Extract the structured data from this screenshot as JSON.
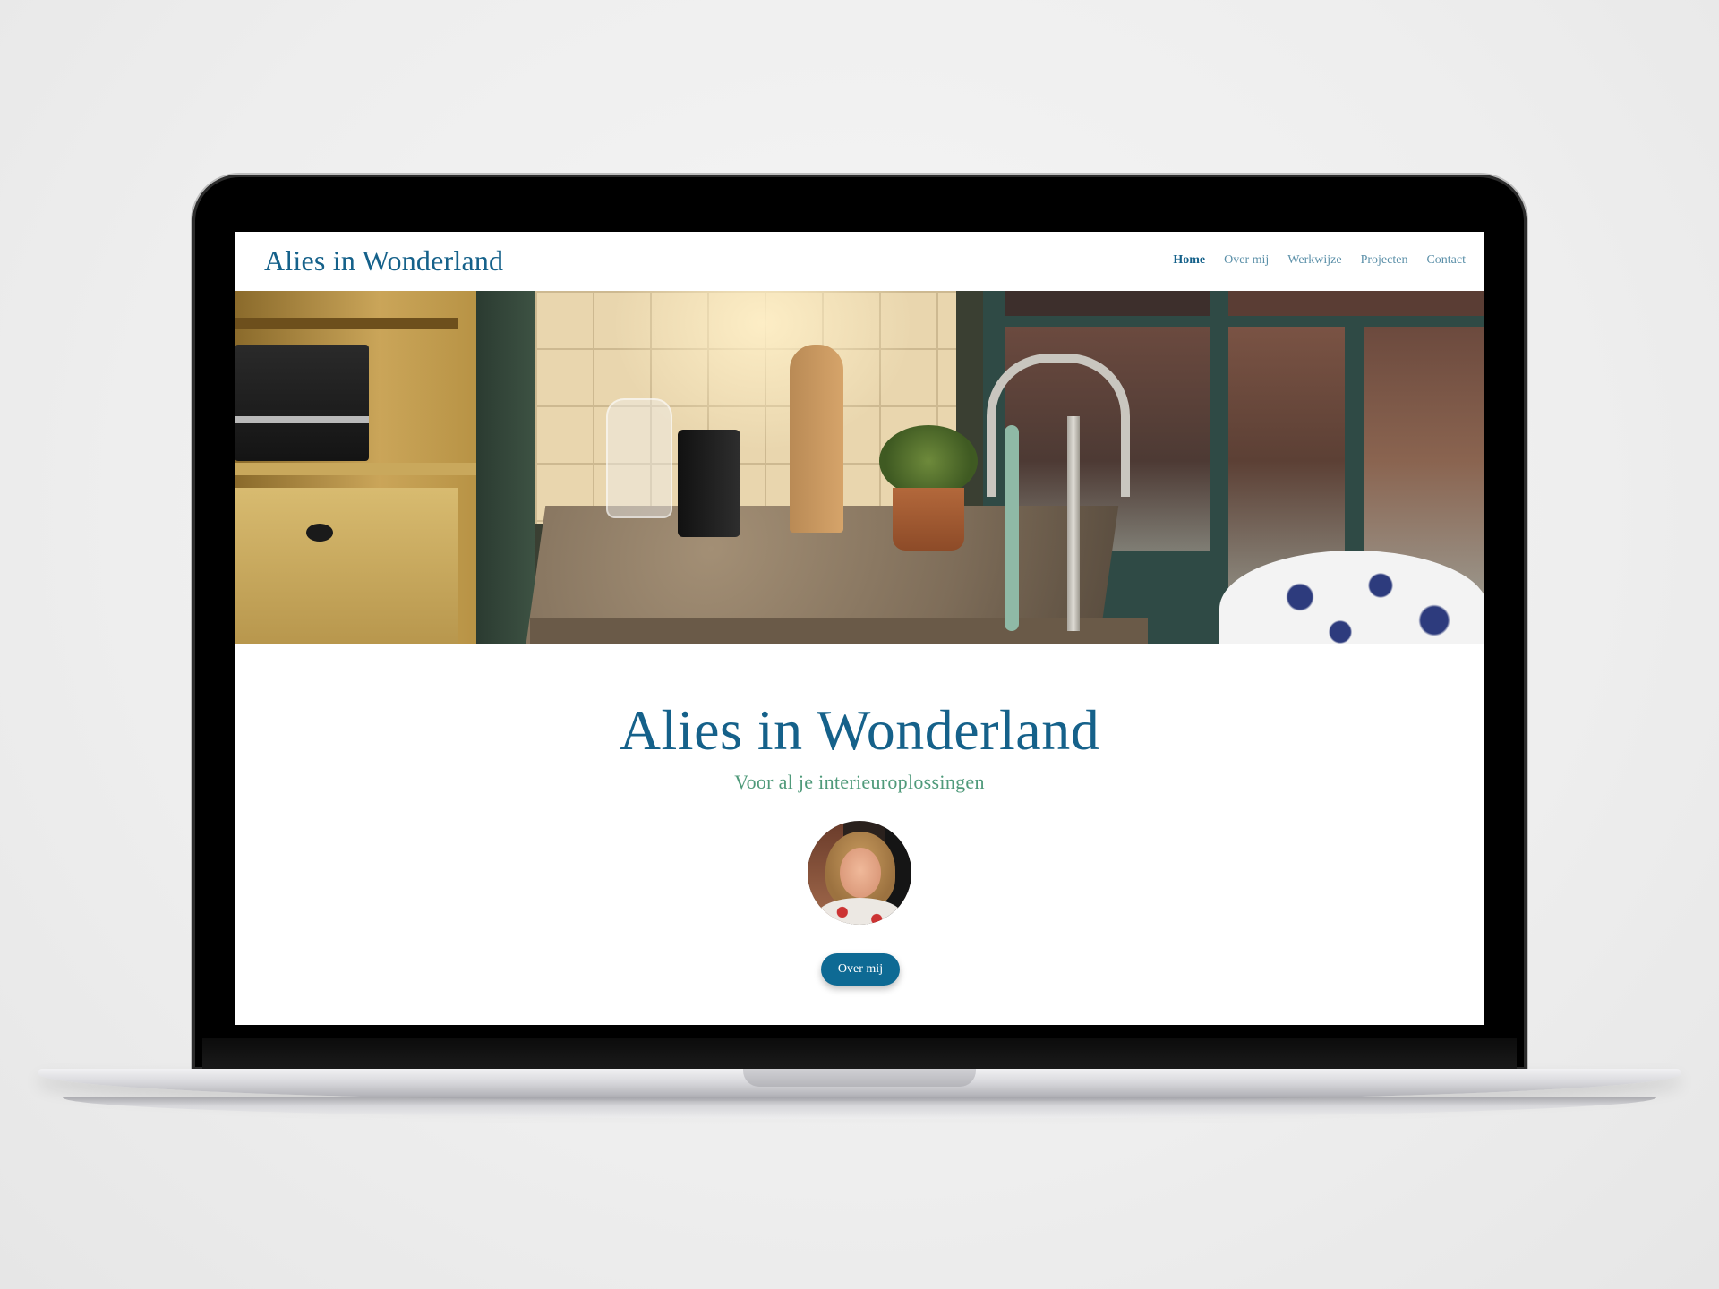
{
  "header": {
    "logo": "Alies in Wonderland",
    "nav": [
      {
        "label": "Home",
        "active": true
      },
      {
        "label": "Over mij",
        "active": false
      },
      {
        "label": "Werkwijze",
        "active": false
      },
      {
        "label": "Projecten",
        "active": false
      },
      {
        "label": "Contact",
        "active": false
      }
    ]
  },
  "hero": {
    "image": "kitchen-counter-photo"
  },
  "main": {
    "title": "Alies in Wonderland",
    "subtitle": "Voor al je interieuroplossingen",
    "avatar": "portrait-photo",
    "cta_label": "Over mij"
  },
  "colors": {
    "primary": "#15618a",
    "accent_green": "#4f9a7a",
    "button": "#0e6a94",
    "nav_inactive": "#5a8fa8"
  }
}
